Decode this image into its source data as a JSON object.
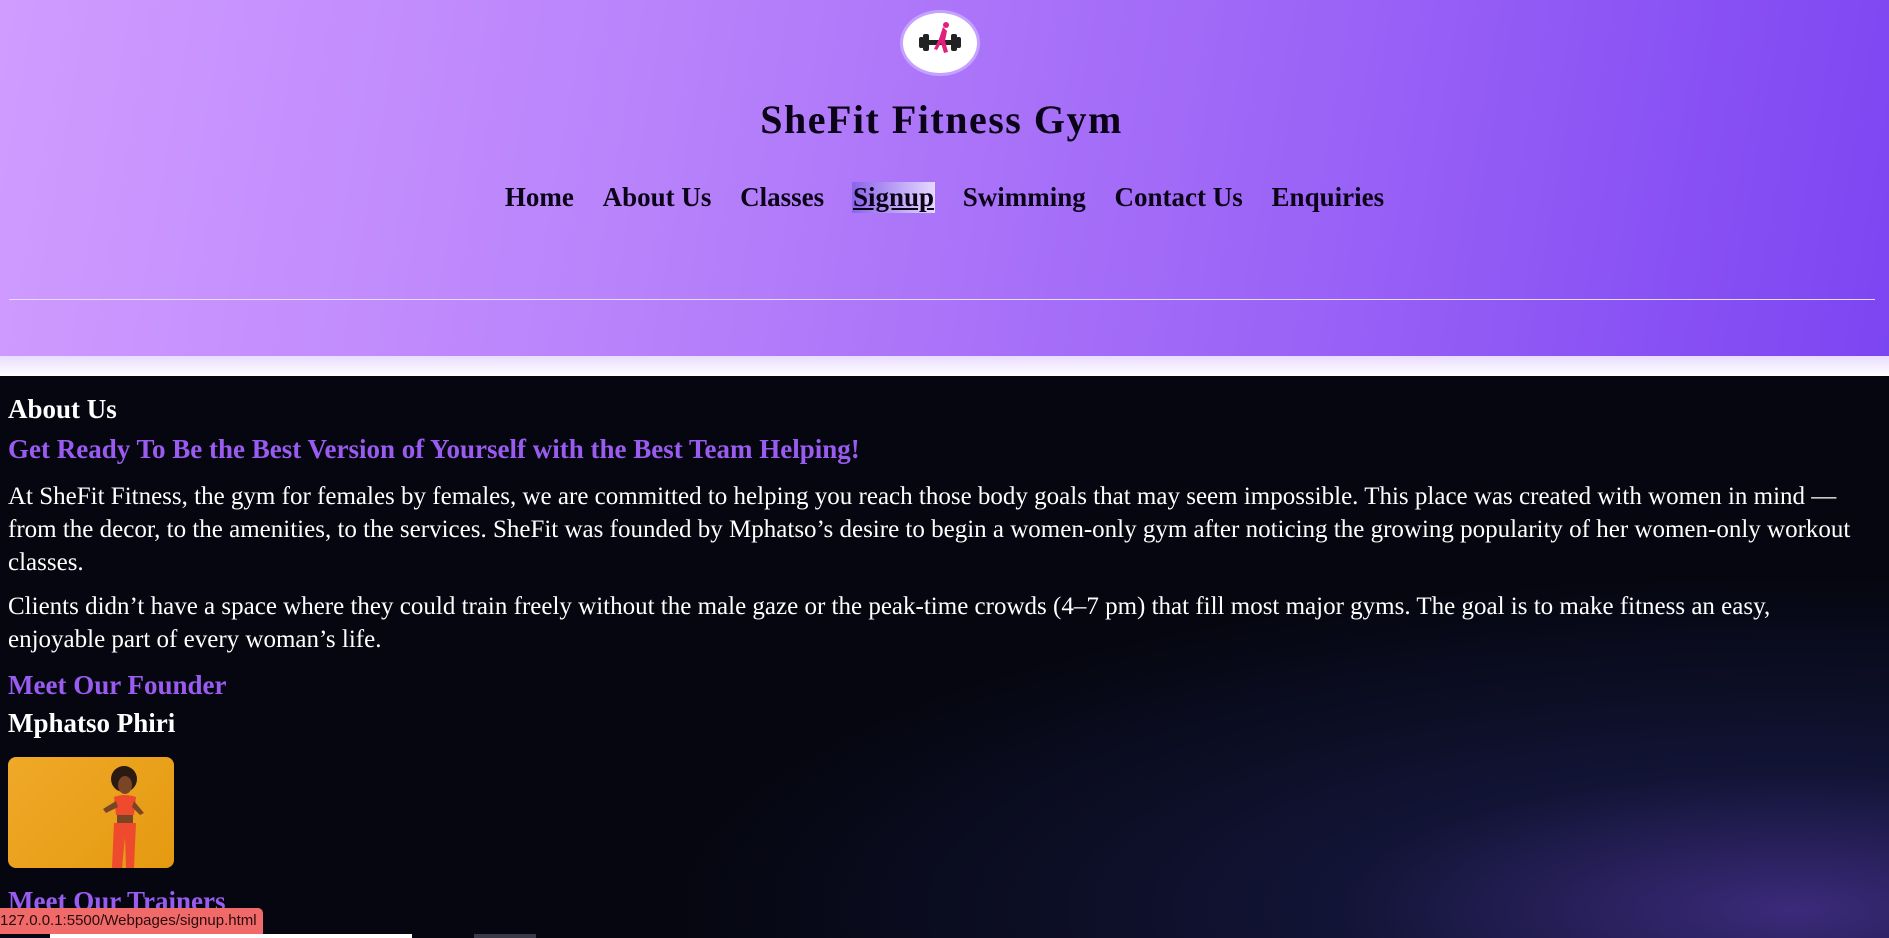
{
  "header": {
    "title": "SheFit Fitness Gym",
    "logo_icon": "dumbbell-woman-logo-icon"
  },
  "nav": {
    "items": [
      {
        "label": "Home"
      },
      {
        "label": "About Us"
      },
      {
        "label": "Classes"
      },
      {
        "label": "Signup",
        "active": true
      },
      {
        "label": "Swimming"
      },
      {
        "label": "Contact Us"
      },
      {
        "label": "Enquiries"
      }
    ]
  },
  "main": {
    "heading": "About Us",
    "tagline": "Get Ready To Be the Best Version of Yourself with the Best Team Helping!",
    "paragraphs": [
      "At SheFit Fitness, the gym for females by females, we are committed to helping you reach those body goals that may seem impossible. This place was created with women in mind — from the decor, to the amenities, to the services. SheFit was founded by Mphatso’s desire to begin a women-only gym after noticing the growing popularity of her women-only workout classes.",
      "Clients didn’t have a space where they could train freely without the male gaze or the peak-time crowds (4–7 pm) that fill most major gyms. The goal is to make fitness an easy, enjoyable part of every woman’s life."
    ],
    "founder_heading": "Meet Our Founder",
    "founder_name": "Mphatso Phiri",
    "trainers_heading": "Meet Our Trainers"
  },
  "status_bar": {
    "url": "127.0.0.1:5500/Webpages/signup.html"
  },
  "colors": {
    "accent_purple": "#9a5cf0",
    "header_start": "#d09cff",
    "header_end": "#7c45f2",
    "background_dark": "#05060f"
  }
}
